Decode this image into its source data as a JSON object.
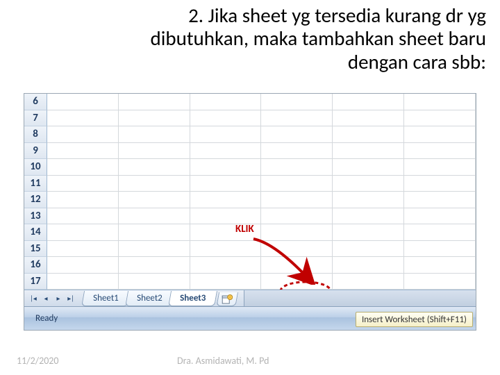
{
  "title": "2. Jika sheet yg tersedia kurang dr yg dibutuhkan, maka tambahkan sheet baru dengan cara  sbb:",
  "annotation": {
    "klik": "KLIK"
  },
  "grid": {
    "rowStart": 6,
    "rowEnd": 17,
    "cols": 6
  },
  "tabs": [
    {
      "label": "Sheet1",
      "active": false
    },
    {
      "label": "Sheet2",
      "active": false
    },
    {
      "label": "Sheet3",
      "active": true
    }
  ],
  "newSheetIcon": "insert-worksheet",
  "status": {
    "ready": "Ready"
  },
  "tooltip": "Insert Worksheet (Shift+F11)",
  "footer": {
    "date": "11/2/2020",
    "author": "Dra. Asmidawati, M. Pd"
  }
}
